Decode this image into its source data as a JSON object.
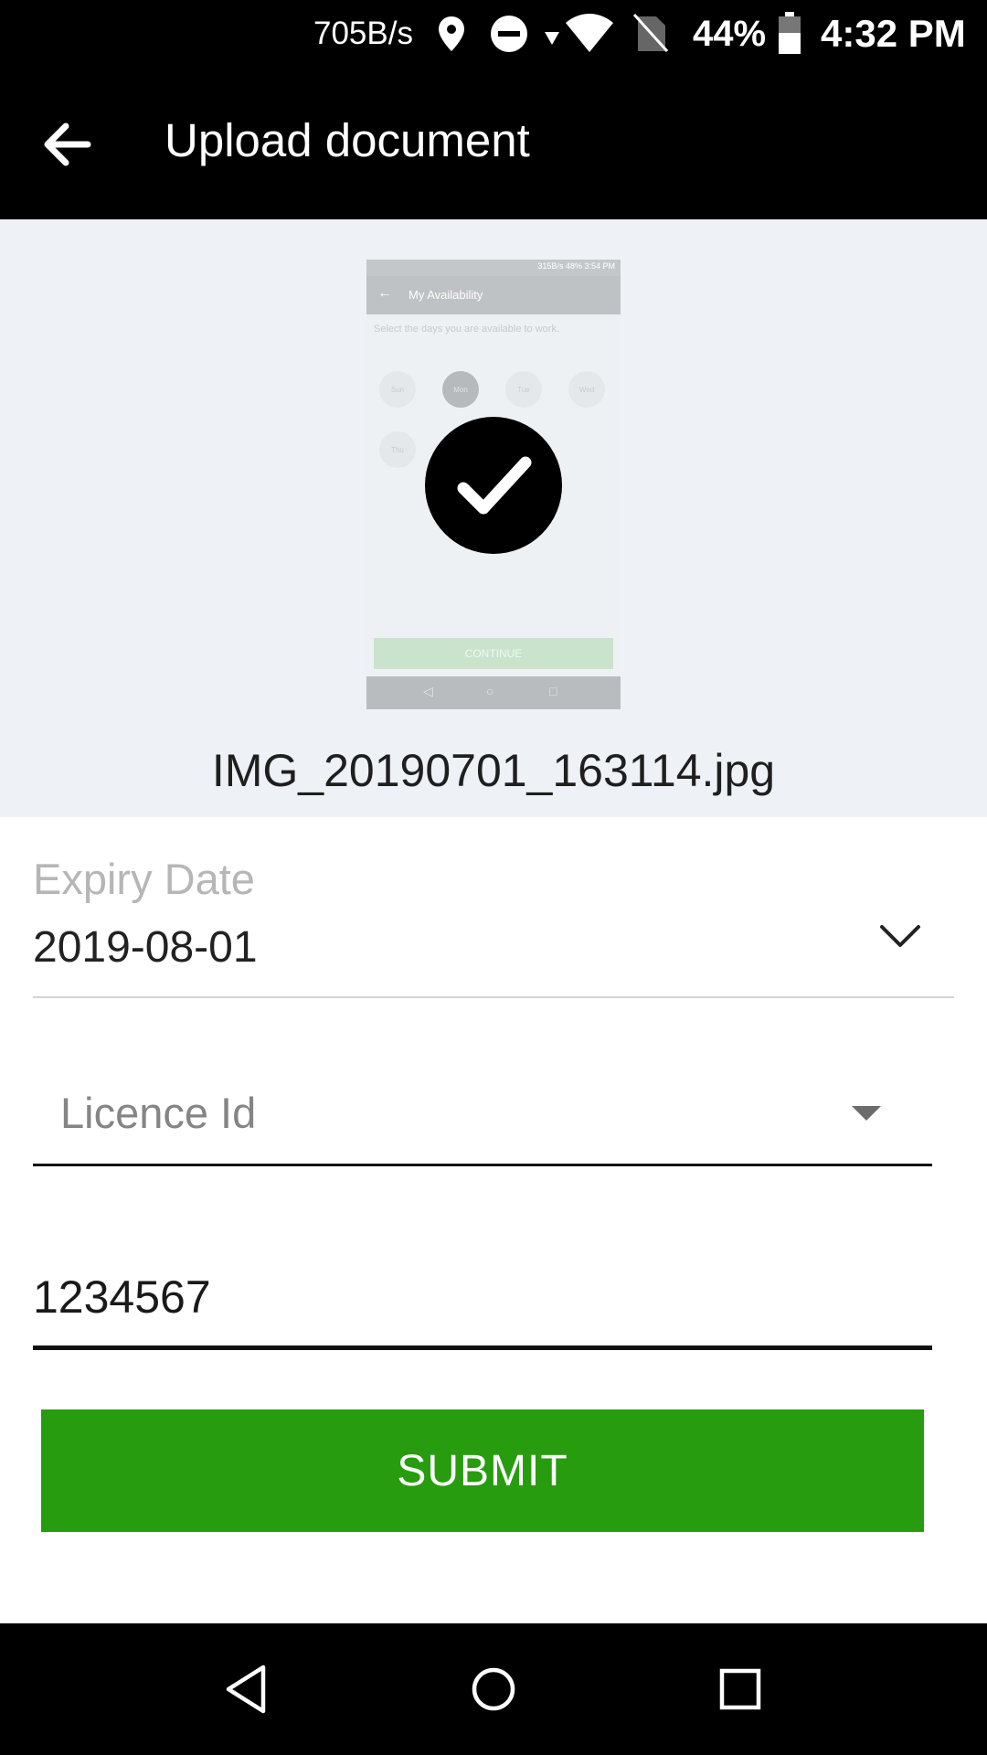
{
  "status_bar": {
    "net_speed": "705B/s",
    "battery": "44%",
    "time": "4:32 PM",
    "icons": [
      "location-icon",
      "dnd-icon",
      "wifi-icon",
      "no-sim-icon",
      "battery-icon"
    ]
  },
  "app_bar": {
    "title": "Upload document",
    "back_icon": "arrow-back-icon"
  },
  "preview": {
    "thumbnail": {
      "status_text": "315B/s  48% 3:54 PM",
      "title": "My Availability",
      "subtitle": "Select the days you are available to work.",
      "days": [
        "Sun",
        "Mon",
        "Tue",
        "Wed",
        "Thu"
      ],
      "selected_day": "Mon",
      "continue_label": "CONTINUE"
    },
    "check_icon": "checkmark-icon",
    "file_name": "IMG_20190701_163114.jpg"
  },
  "form": {
    "expiry": {
      "label": "Expiry Date",
      "value": "2019-08-01",
      "icon": "chevron-down-icon"
    },
    "licence": {
      "placeholder": "Licence Id",
      "icon": "dropdown-arrow-icon"
    },
    "number": {
      "value": "1234567"
    },
    "submit_label": "SUBMIT"
  },
  "colors": {
    "submit": "#279c0e",
    "bars": "#000000",
    "preview_bg": "#eef2f6"
  }
}
